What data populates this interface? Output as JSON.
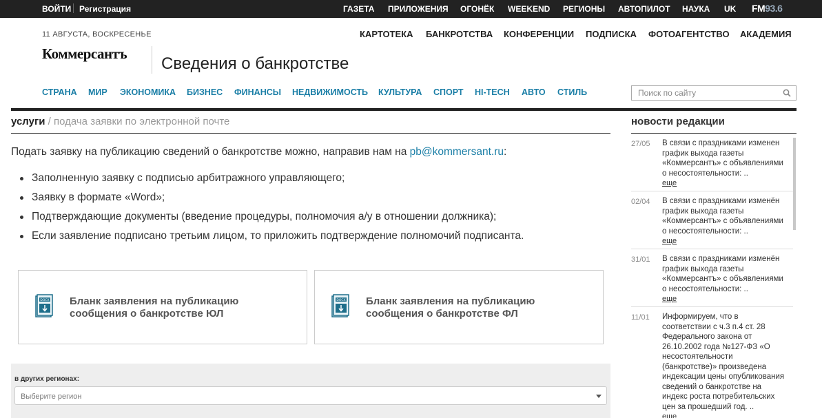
{
  "topbar": {
    "login": "ВОЙТИ",
    "register": "Регистрация",
    "nav": [
      "ГАЗЕТА",
      "ПРИЛОЖЕНИЯ",
      "ОГОНЁК",
      "WEEKEND",
      "РЕГИОНЫ",
      "АВТОПИЛОТ",
      "НАУКА",
      "UK"
    ],
    "fm_label": "FM",
    "fm_freq": "93.6"
  },
  "header": {
    "date": "11 АВГУСТА, ВОСКРЕСЕНЬЕ",
    "right_nav": [
      "КАРТОТЕКА",
      "БАНКРОТСТВА",
      "КОНФЕРЕНЦИИ",
      "ПОДПИСКА",
      "ФОТОАГЕНТСТВО",
      "АКАДЕМИЯ"
    ],
    "logo": "Коммерсантъ",
    "section_title": "Сведения о банкротстве",
    "main_nav": [
      "СТРАНА",
      "МИР",
      "ЭКОНОМИКА",
      "БИЗНЕС",
      "ФИНАНСЫ",
      "НЕДВИЖИМОСТЬ",
      "КУЛЬТУРА",
      "СПОРТ",
      "HI-TECH",
      "АВТО",
      "СТИЛЬ"
    ],
    "search_placeholder": "Поиск по сайту"
  },
  "breadcrumb": {
    "root": "услуги",
    "separator": " / ",
    "current": "подача заявки по электронной почте"
  },
  "content": {
    "intro": "Подать заявку на публикацию сведений о банкротстве можно, направив нам на ",
    "email": "pb@kommersant.ru",
    "intro_end": ":",
    "bullets": [
      "Заполненную заявку с подписью арбитражного управляющего;",
      "Заявку в формате «Word»;",
      "Подтверждающие документы (введение процедуры, полномочия а/у в отношении должника);",
      "Если заявление подписано третьим лицом, то приложить подтверждение полномочий подписанта."
    ],
    "cards": [
      {
        "line1": "Бланк заявления на публикацию",
        "line2": "сообщения о банкротстве ЮЛ",
        "icon_label": "DOCX"
      },
      {
        "line1": "Бланк заявления на публикацию",
        "line2": "сообщения о банкротстве ФЛ",
        "icon_label": "DOCX"
      }
    ],
    "region_label": "в других регионах:",
    "region_placeholder": "Выберите регион"
  },
  "news": {
    "title": "новости редакции",
    "more": "еще",
    "items": [
      {
        "date": "27/05",
        "lines": [
          "В связи с праздниками изменен",
          "график выхода газеты",
          "«Коммерсантъ» с объявлениями",
          "о несостоятельности: .."
        ]
      },
      {
        "date": "02/04",
        "lines": [
          "В связи с праздниками изменён",
          "график выхода газеты",
          "«Коммерсантъ» с объявлениями",
          "о несостоятельности: .."
        ]
      },
      {
        "date": "31/01",
        "lines": [
          "В связи с праздниками изменён",
          "график выхода газеты",
          "«Коммерсантъ» с объявлениями",
          "о несостоятельности: .."
        ]
      },
      {
        "date": "11/01",
        "lines": [
          "Информируем, что в",
          "соответствии с ч.3 п.4 ст. 28",
          "Федерального закона от",
          "26.10.2002 года №127-ФЗ «О",
          "несостоятельности",
          "(банкротстве)» произведена",
          "индексации цены опубликования",
          "сведений о банкротстве на",
          "индекс роста потребительских",
          "цен за прошедший год. .."
        ]
      }
    ]
  },
  "colors": {
    "accent": "#1a7ea6",
    "topbar": "#222222",
    "icon": "#1f6f8b"
  }
}
